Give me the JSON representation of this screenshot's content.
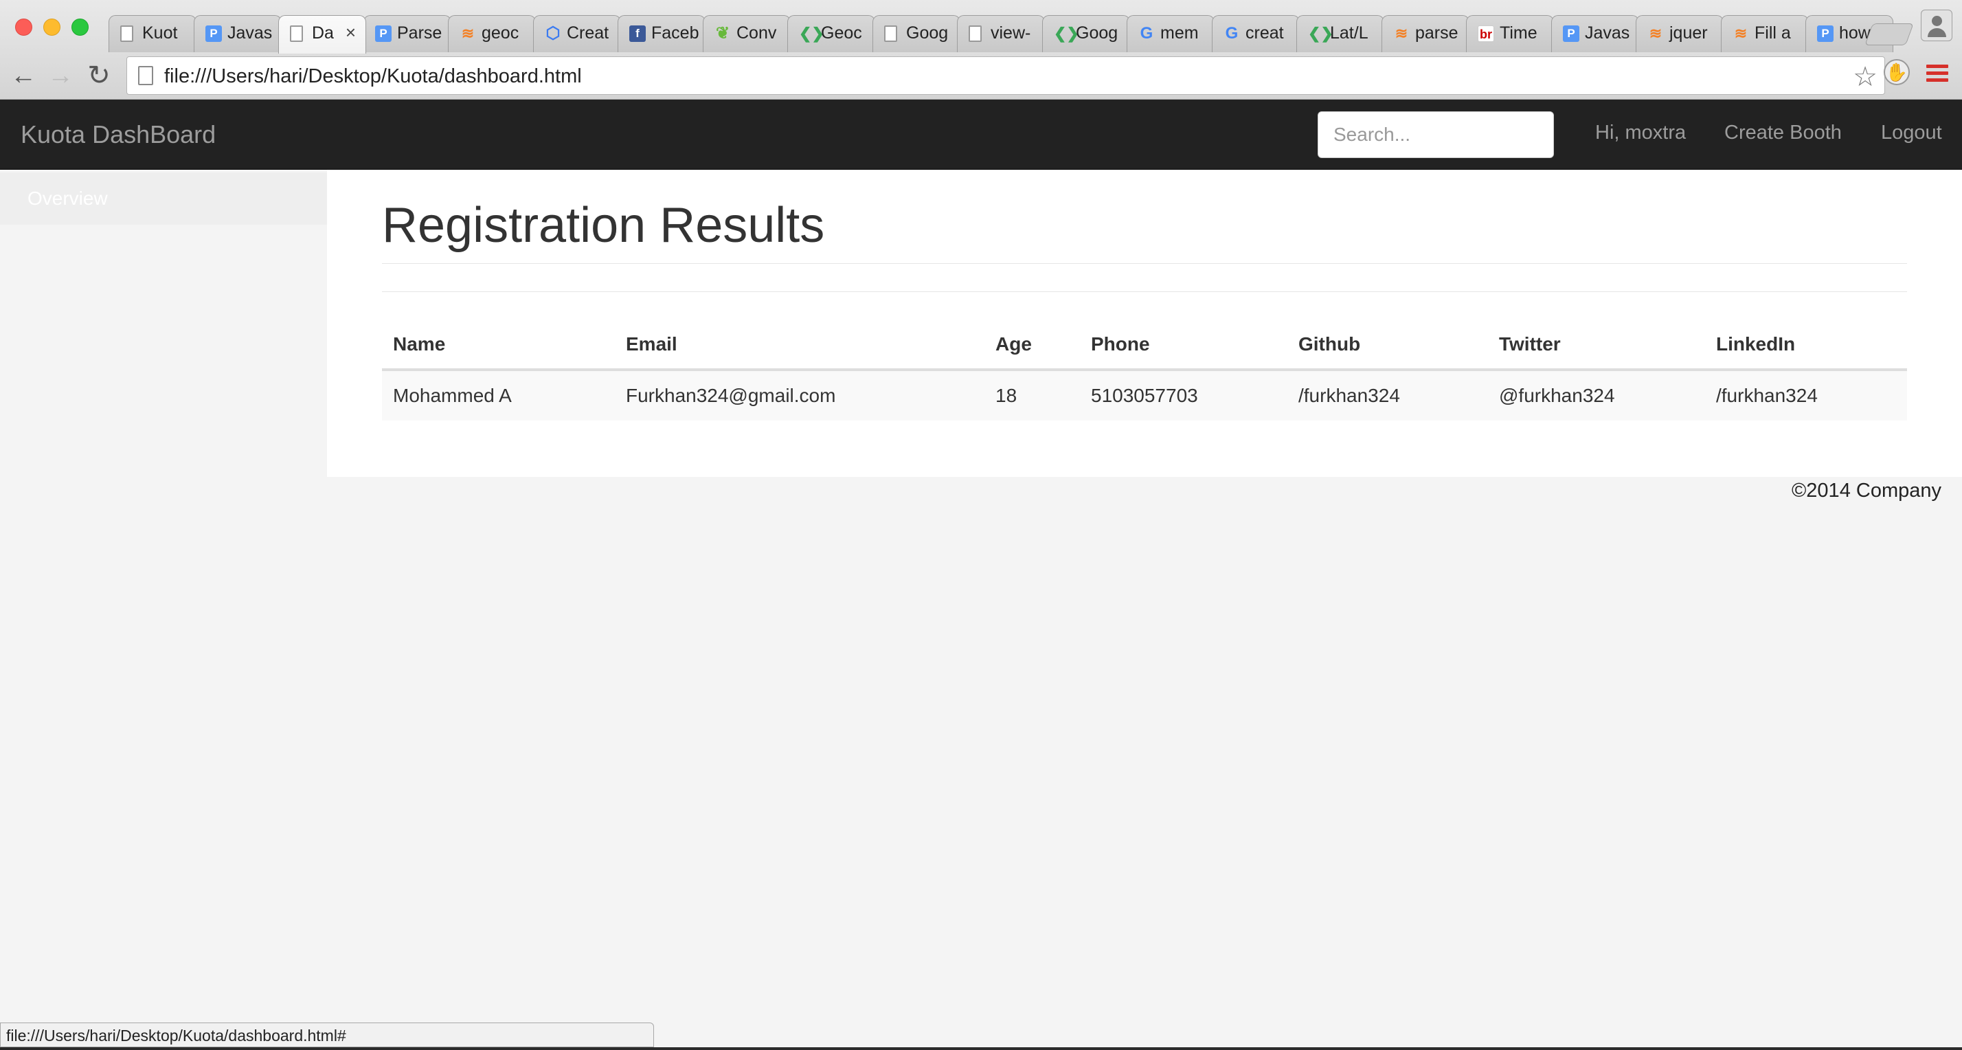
{
  "browser": {
    "tabs": [
      {
        "label": "Kuot",
        "icon": "document-icon",
        "active": false
      },
      {
        "label": "Javas",
        "icon": "parse-icon",
        "active": false
      },
      {
        "label": "Da",
        "icon": "document-icon",
        "active": true
      },
      {
        "label": "Parse",
        "icon": "parse-icon",
        "active": false
      },
      {
        "label": "geoc",
        "icon": "stackoverflow-icon",
        "active": false
      },
      {
        "label": "Creat",
        "icon": "google-cloud-icon",
        "active": false
      },
      {
        "label": "Faceb",
        "icon": "facebook-icon",
        "active": false
      },
      {
        "label": "Conv",
        "icon": "leaf-icon",
        "active": false
      },
      {
        "label": "Geoc",
        "icon": "google-maps-icon",
        "active": false
      },
      {
        "label": "Goog",
        "icon": "document-icon",
        "active": false
      },
      {
        "label": "view-",
        "icon": "document-icon",
        "active": false
      },
      {
        "label": "Goog",
        "icon": "google-maps-icon",
        "active": false
      },
      {
        "label": "mem",
        "icon": "google-icon",
        "active": false
      },
      {
        "label": "creat",
        "icon": "google-icon",
        "active": false
      },
      {
        "label": "Lat/L",
        "icon": "google-maps-icon",
        "active": false
      },
      {
        "label": "parse",
        "icon": "stackoverflow-icon",
        "active": false
      },
      {
        "label": "Time",
        "icon": "br-icon",
        "active": false
      },
      {
        "label": "Javas",
        "icon": "parse-icon",
        "active": false
      },
      {
        "label": "jquer",
        "icon": "stackoverflow-icon",
        "active": false
      },
      {
        "label": "Fill a",
        "icon": "stackoverflow-icon",
        "active": false
      },
      {
        "label": "how t",
        "icon": "parse-icon",
        "active": false
      }
    ],
    "url": "file:///Users/hari/Desktop/Kuota/dashboard.html",
    "status_url": "file:///Users/hari/Desktop/Kuota/dashboard.html#"
  },
  "navbar": {
    "brand": "Kuota DashBoard",
    "search_placeholder": "Search...",
    "links": [
      "Hi, moxtra",
      "Create Booth",
      "Logout"
    ]
  },
  "sidebar": {
    "items": [
      {
        "label": "Overview"
      }
    ]
  },
  "main": {
    "title": "Registration Results",
    "table": {
      "columns": [
        "Name",
        "Email",
        "Age",
        "Phone",
        "Github",
        "Twitter",
        "LinkedIn"
      ],
      "rows": [
        [
          "Mohammed A",
          "Furkhan324@gmail.com",
          "18",
          "5103057703",
          "/furkhan324",
          "@furkhan324",
          "/furkhan324"
        ]
      ]
    }
  },
  "footer": {
    "text": "©2014 Company"
  },
  "colors": {
    "navbar_bg": "#222222",
    "navbar_text": "#9d9d9d",
    "page_bg": "#f4f4f4",
    "menu_accent": "#d6302a"
  }
}
